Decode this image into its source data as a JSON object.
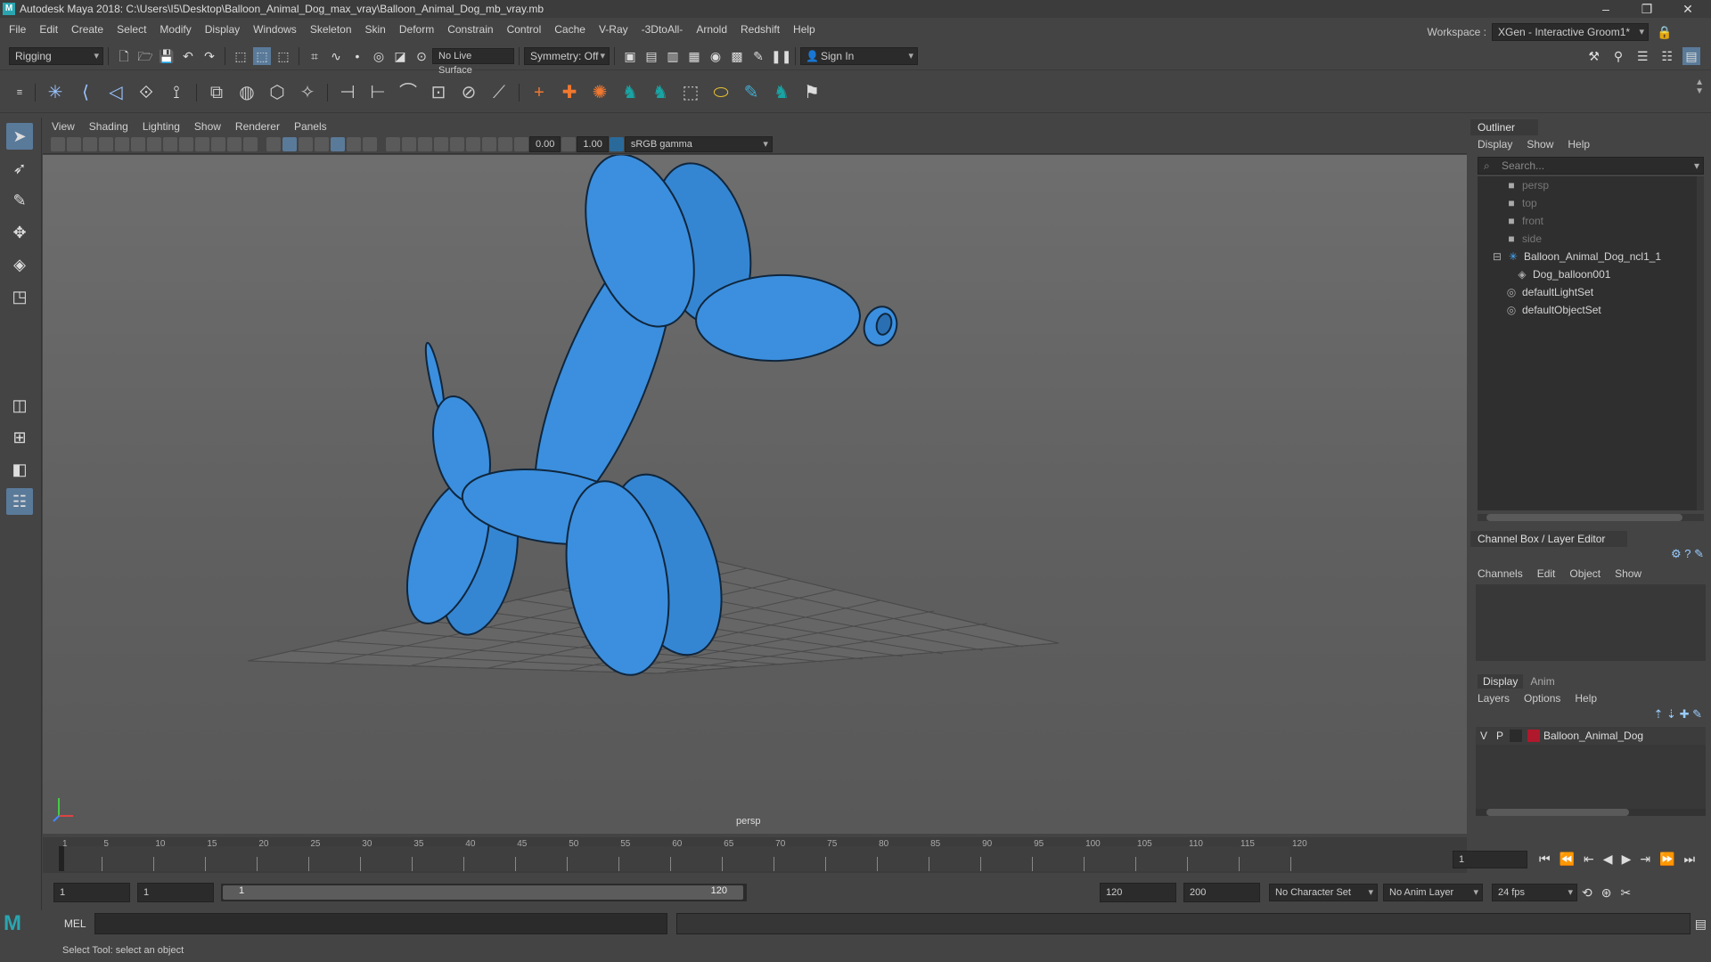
{
  "window": {
    "title": "Autodesk Maya 2018: C:\\Users\\I5\\Desktop\\Balloon_Animal_Dog_max_vray\\Balloon_Animal_Dog_mb_vray.mb",
    "minimize": "–",
    "maximize": "❐",
    "close": "✕"
  },
  "menubar": {
    "items": [
      "File",
      "Edit",
      "Create",
      "Select",
      "Modify",
      "Display",
      "Windows",
      "Skeleton",
      "Skin",
      "Deform",
      "Constrain",
      "Control",
      "Cache",
      "V-Ray",
      "-3DtoAll-",
      "Arnold",
      "Redshift",
      "Help"
    ],
    "workspace_label": "Workspace :",
    "workspace_value": "XGen - Interactive Groom1*"
  },
  "statusline": {
    "mode": "Rigging",
    "live_surface": "No Live Surface",
    "symmetry": "Symmetry: Off",
    "sign_in": "Sign In"
  },
  "viewport": {
    "menus": [
      "View",
      "Shading",
      "Lighting",
      "Show",
      "Renderer",
      "Panels"
    ],
    "exposure": "0.00",
    "gamma": "1.00",
    "color_space": "sRGB gamma",
    "camera_label": "persp",
    "object_color": "#3b8fde"
  },
  "outliner": {
    "title": "Outliner",
    "menus": [
      "Display",
      "Show",
      "Help"
    ],
    "search_placeholder": "Search...",
    "items": [
      {
        "label": "persp",
        "icon": "camera-icon",
        "dim": true,
        "indent": 1
      },
      {
        "label": "top",
        "icon": "camera-icon",
        "dim": true,
        "indent": 1
      },
      {
        "label": "front",
        "icon": "camera-icon",
        "dim": true,
        "indent": 1
      },
      {
        "label": "side",
        "icon": "camera-icon",
        "dim": true,
        "indent": 1
      },
      {
        "label": "Balloon_Animal_Dog_ncl1_1",
        "icon": "joint-icon",
        "dim": false,
        "indent": 1
      },
      {
        "label": "Dog_balloon001",
        "icon": "mesh-icon",
        "dim": false,
        "indent": 2
      },
      {
        "label": "defaultLightSet",
        "icon": "set-icon",
        "dim": false,
        "indent": 1
      },
      {
        "label": "defaultObjectSet",
        "icon": "set-icon",
        "dim": false,
        "indent": 1
      }
    ]
  },
  "channelbox": {
    "title": "Channel Box / Layer Editor",
    "menus": [
      "Channels",
      "Edit",
      "Object",
      "Show"
    ],
    "tabs": [
      "Display",
      "Anim"
    ],
    "layer_menus": [
      "Layers",
      "Options",
      "Help"
    ],
    "layer": {
      "v": "V",
      "p": "P",
      "name": "Balloon_Animal_Dog",
      "color": "#b0182c"
    }
  },
  "timeline": {
    "ticks": [
      "1",
      "5",
      "10",
      "15",
      "20",
      "25",
      "30",
      "35",
      "40",
      "45",
      "50",
      "55",
      "60",
      "65",
      "70",
      "75",
      "80",
      "85",
      "90",
      "95",
      "100",
      "105",
      "110",
      "115",
      "120"
    ],
    "current_frame": "1"
  },
  "range": {
    "start": "1",
    "inner_start": "1",
    "slider_start": "1",
    "slider_end": "120",
    "end": "120",
    "outer_end": "200",
    "character_set": "No Character Set",
    "anim_layer": "No Anim Layer",
    "fps": "24 fps"
  },
  "commandline": {
    "label": "MEL"
  },
  "helpline": {
    "text": "Select Tool: select an object"
  }
}
